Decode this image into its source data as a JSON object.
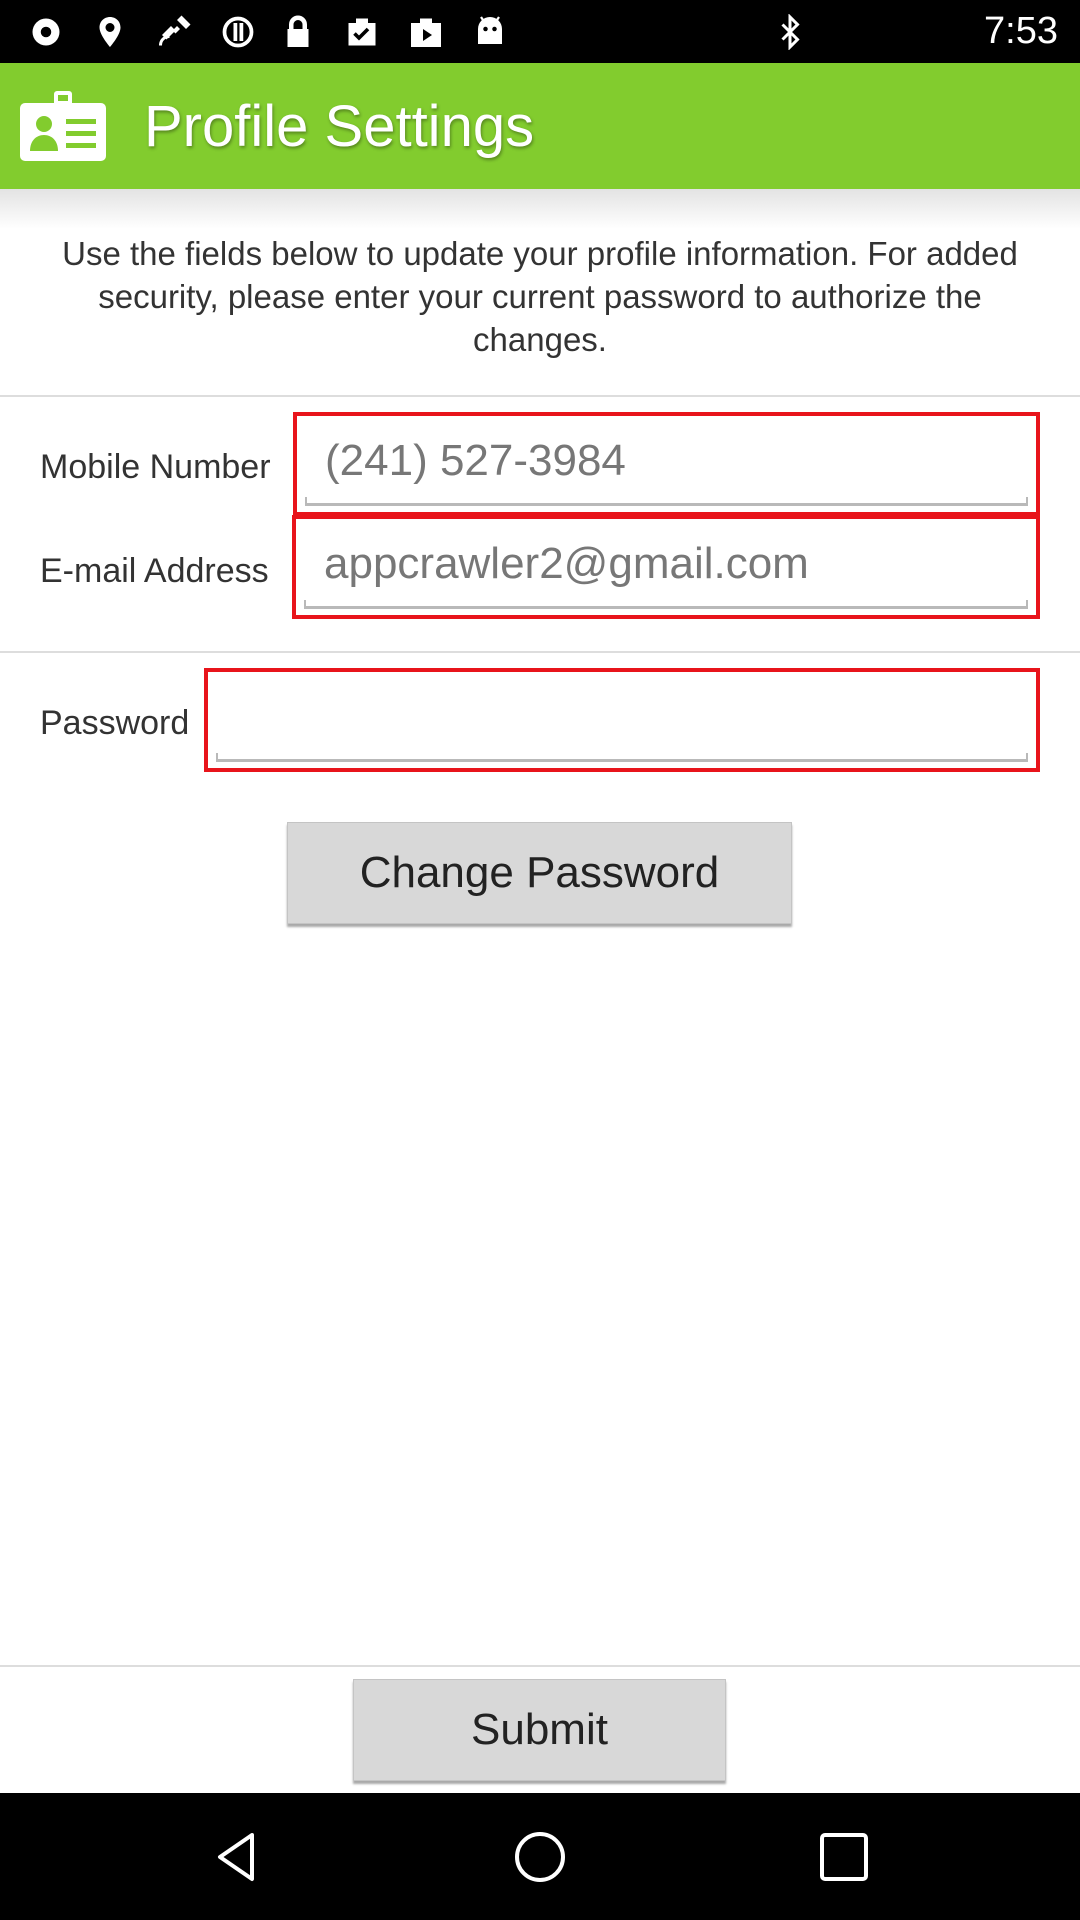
{
  "status_bar": {
    "time": "7:53",
    "left_icons": [
      "record-icon",
      "fake-gps-icon",
      "satellite-icon",
      "sync-icon",
      "lock-icon",
      "task-icon",
      "play-store-icon",
      "android-icon"
    ],
    "right_icons": [
      "bluetooth-icon"
    ]
  },
  "header": {
    "title": "Profile Settings",
    "icon": "profile-card-icon",
    "background": "#82cc2e"
  },
  "intro": {
    "text": "Use the fields below to update your profile information. For added security, please enter your current password to authorize the changes."
  },
  "form": {
    "mobile": {
      "label": "Mobile Number",
      "value": "(241) 527-3984"
    },
    "email": {
      "label": "E-mail Address",
      "value": "appcrawler2@gmail.com"
    },
    "password": {
      "label": "Password",
      "value": ""
    }
  },
  "buttons": {
    "change_password": "Change Password",
    "submit": "Submit"
  },
  "highlight_color": "#e8141b",
  "nav_bar": {
    "icons": [
      "back-icon",
      "home-icon",
      "recents-icon"
    ]
  }
}
